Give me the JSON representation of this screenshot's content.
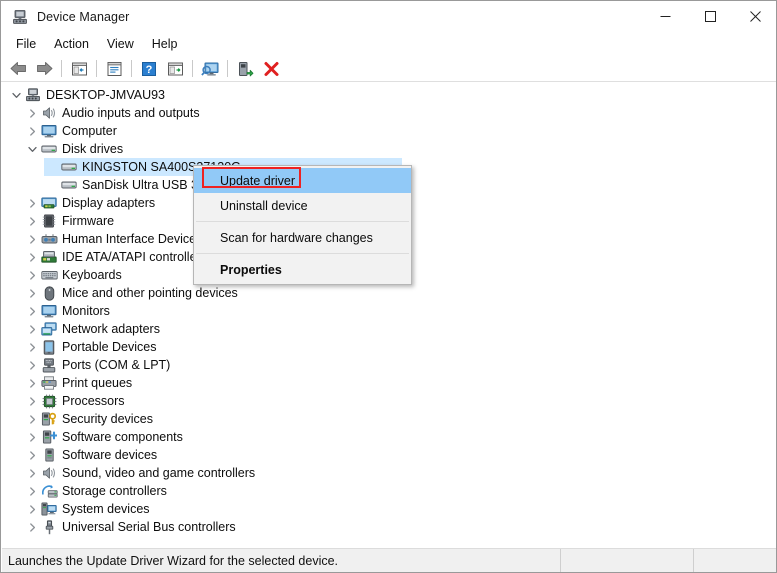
{
  "window": {
    "title": "Device Manager",
    "icon": "device-manager-icon",
    "minimize_label": "─",
    "maximize_label": "□",
    "close_label": "✕"
  },
  "menubar": {
    "items": [
      {
        "label": "File"
      },
      {
        "label": "Action"
      },
      {
        "label": "View"
      },
      {
        "label": "Help"
      }
    ]
  },
  "toolbar": {
    "buttons": [
      {
        "name": "back-icon",
        "title": "Back"
      },
      {
        "name": "forward-icon",
        "title": "Forward"
      },
      {
        "name": "separator-1",
        "title": ""
      },
      {
        "name": "show-hide-console-tree-icon",
        "title": "Show/Hide Console Tree"
      },
      {
        "name": "separator-2",
        "title": ""
      },
      {
        "name": "properties-icon",
        "title": "Properties"
      },
      {
        "name": "separator-3",
        "title": ""
      },
      {
        "name": "help-icon",
        "title": "Help"
      },
      {
        "name": "update-driver-icon",
        "title": "Update Driver"
      },
      {
        "name": "separator-4",
        "title": ""
      },
      {
        "name": "scan-for-hardware-changes-icon",
        "title": "Scan for hardware changes"
      },
      {
        "name": "separator-5",
        "title": ""
      },
      {
        "name": "enable-device-icon",
        "title": "Enable device"
      },
      {
        "name": "uninstall-device-icon",
        "title": "Uninstall device"
      }
    ]
  },
  "tree": {
    "root": {
      "label": "DESKTOP-JMVAU93",
      "icon": "computer-root-icon",
      "expanded": true,
      "level": 0
    },
    "items": [
      {
        "label": "Audio inputs and outputs",
        "icon": "speaker-icon",
        "level": 1,
        "expandable": true,
        "expanded": false
      },
      {
        "label": "Computer",
        "icon": "monitor-icon",
        "level": 1,
        "expandable": true,
        "expanded": false
      },
      {
        "label": "Disk drives",
        "icon": "disk-drive-icon",
        "level": 1,
        "expandable": true,
        "expanded": true
      },
      {
        "label": "KINGSTON SA400S37120G",
        "icon": "disk-drive-icon",
        "level": 2,
        "expandable": false,
        "selected": true
      },
      {
        "label": "SanDisk Ultra USB 3.0 USB Device",
        "icon": "disk-drive-icon",
        "level": 2,
        "expandable": false
      },
      {
        "label": "Display adapters",
        "icon": "display-adapter-icon",
        "level": 1,
        "expandable": true,
        "expanded": false
      },
      {
        "label": "Firmware",
        "icon": "firmware-icon",
        "level": 1,
        "expandable": true,
        "expanded": false
      },
      {
        "label": "Human Interface Devices",
        "icon": "hid-icon",
        "level": 1,
        "expandable": true,
        "expanded": false
      },
      {
        "label": "IDE ATA/ATAPI controllers",
        "icon": "ide-controller-icon",
        "level": 1,
        "expandable": true,
        "expanded": false
      },
      {
        "label": "Keyboards",
        "icon": "keyboard-icon",
        "level": 1,
        "expandable": true,
        "expanded": false
      },
      {
        "label": "Mice and other pointing devices",
        "icon": "mouse-icon",
        "level": 1,
        "expandable": true,
        "expanded": false
      },
      {
        "label": "Monitors",
        "icon": "monitor-icon",
        "level": 1,
        "expandable": true,
        "expanded": false
      },
      {
        "label": "Network adapters",
        "icon": "network-adapter-icon",
        "level": 1,
        "expandable": true,
        "expanded": false
      },
      {
        "label": "Portable Devices",
        "icon": "portable-device-icon",
        "level": 1,
        "expandable": true,
        "expanded": false
      },
      {
        "label": "Ports (COM & LPT)",
        "icon": "port-icon",
        "level": 1,
        "expandable": true,
        "expanded": false
      },
      {
        "label": "Print queues",
        "icon": "printer-icon",
        "level": 1,
        "expandable": true,
        "expanded": false
      },
      {
        "label": "Processors",
        "icon": "processor-icon",
        "level": 1,
        "expandable": true,
        "expanded": false
      },
      {
        "label": "Security devices",
        "icon": "security-device-icon",
        "level": 1,
        "expandable": true,
        "expanded": false
      },
      {
        "label": "Software components",
        "icon": "software-component-icon",
        "level": 1,
        "expandable": true,
        "expanded": false
      },
      {
        "label": "Software devices",
        "icon": "software-device-icon",
        "level": 1,
        "expandable": true,
        "expanded": false
      },
      {
        "label": "Sound, video and game controllers",
        "icon": "speaker-icon",
        "level": 1,
        "expandable": true,
        "expanded": false
      },
      {
        "label": "Storage controllers",
        "icon": "storage-controller-icon",
        "level": 1,
        "expandable": true,
        "expanded": false
      },
      {
        "label": "System devices",
        "icon": "system-device-icon",
        "level": 1,
        "expandable": true,
        "expanded": false
      },
      {
        "label": "Universal Serial Bus controllers",
        "icon": "usb-controller-icon",
        "level": 1,
        "expandable": true,
        "expanded": false
      }
    ]
  },
  "context_menu": {
    "items": [
      {
        "label": "Update driver",
        "highlighted": true,
        "bold": false
      },
      {
        "label": "Uninstall device",
        "highlighted": false,
        "bold": false
      },
      {
        "separator": true
      },
      {
        "label": "Scan for hardware changes",
        "highlighted": false,
        "bold": false
      },
      {
        "separator": true
      },
      {
        "label": "Properties",
        "highlighted": false,
        "bold": true
      }
    ]
  },
  "status_bar": {
    "message": "Launches the Update Driver Wizard for the selected device.",
    "pane2": "",
    "pane3": ""
  },
  "colors": {
    "selection_blue": "#cce8ff",
    "menu_highlight_blue": "#91c9f7",
    "annotation_red": "#ee2222",
    "window_bg": "#ffffff",
    "statusbar_bg": "#f0f0f0"
  }
}
